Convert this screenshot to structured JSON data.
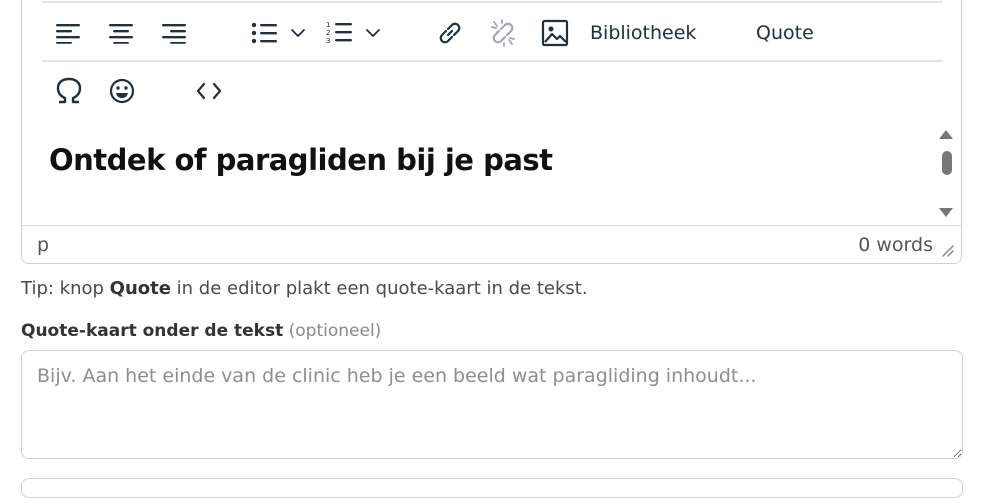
{
  "toolbar": {
    "row1": [
      "align-left-icon",
      "align-center-icon",
      "align-right-icon",
      "bullet-list-icon",
      "numbered-list-icon",
      "link-icon",
      "unlink-icon",
      "image-icon"
    ],
    "library_label": "Bibliotheek",
    "quote_label": "Quote",
    "row2": [
      "omega-icon",
      "emoji-icon",
      "code-icon"
    ]
  },
  "content": {
    "heading_part1": "Ontdek of ",
    "heading_part2": "paragliden",
    "heading_part3": " bij je past"
  },
  "statusbar": {
    "path": "p",
    "word_count": "0 words"
  },
  "tip": {
    "prefix": "Tip: knop ",
    "bold": "Quote",
    "suffix": " in de editor plakt een quote-kaart in de tekst."
  },
  "quote_field": {
    "label": "Quote-kaart onder de tekst",
    "optional": "(optioneel)",
    "placeholder": "Bijv. Aan het einde van de clinic heb je een beeld wat paragliding inhoudt..."
  }
}
